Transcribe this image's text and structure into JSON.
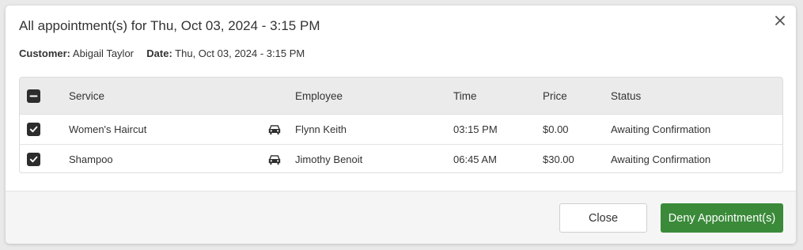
{
  "modal": {
    "title": "All appointment(s) for Thu, Oct 03, 2024 - 3:15 PM",
    "close_icon": "close-icon",
    "customer_label": "Customer:",
    "customer_value": "Abigail Taylor",
    "date_label": "Date:",
    "date_value": "Thu, Oct 03, 2024 - 3:15 PM"
  },
  "table": {
    "headers": {
      "service": "Service",
      "employee": "Employee",
      "time": "Time",
      "price": "Price",
      "status": "Status"
    },
    "select_all_state": "indeterminate",
    "rows": [
      {
        "checked": true,
        "service": "Women's Haircut",
        "icon": "car-icon",
        "employee": "Flynn Keith",
        "time": "03:15 PM",
        "price": "$0.00",
        "status": "Awaiting Confirmation"
      },
      {
        "checked": true,
        "service": "Shampoo",
        "icon": "car-icon",
        "employee": "Jimothy Benoit",
        "time": "06:45 AM",
        "price": "$30.00",
        "status": "Awaiting Confirmation"
      }
    ]
  },
  "footer": {
    "close_label": "Close",
    "deny_label": "Deny Appointment(s)"
  },
  "colors": {
    "deny_button": "#3a8a3a",
    "header_bg": "#ebebeb",
    "checkbox": "#2d2d2d"
  }
}
